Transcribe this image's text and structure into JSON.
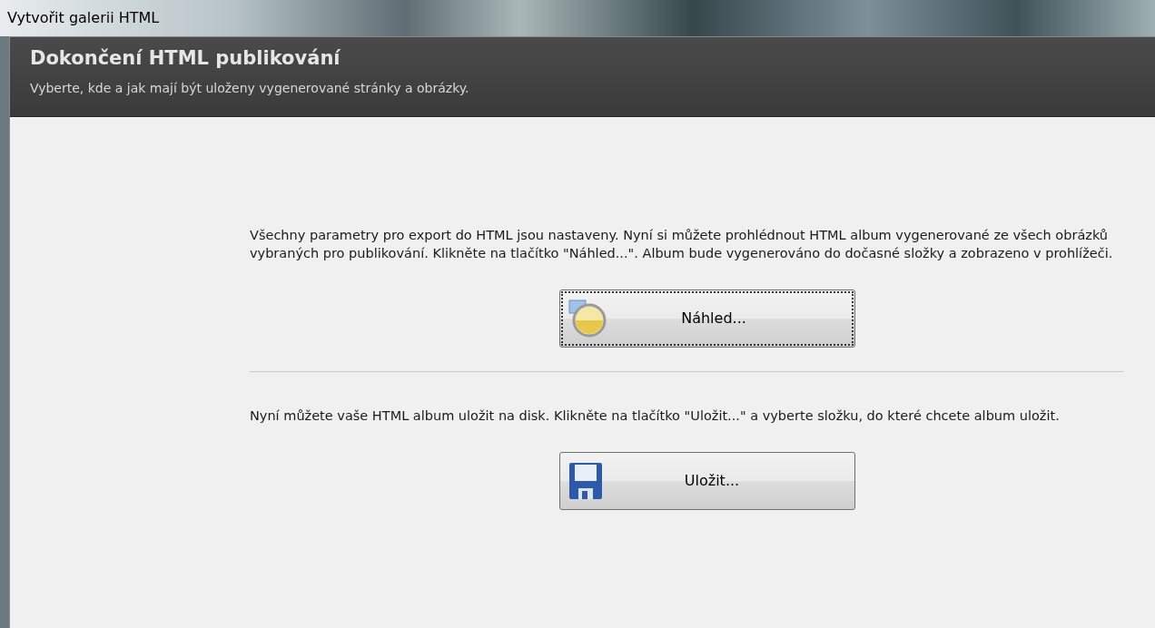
{
  "window": {
    "title": "Vytvořit galerii HTML"
  },
  "header": {
    "title": "Dokončení HTML publikování",
    "subtitle": "Vyberte, kde a jak mají být uloženy vygenerované stránky a obrázky."
  },
  "sections": [
    {
      "text": "Všechny parametry pro export do HTML jsou nastaveny. Nyní si můžete prohlédnout HTML album vygenerované ze všech obrázků vybraných pro publikování. Klikněte na tlačítko \"Náhled...\". Album bude vygenerováno do dočasné složky a zobrazeno v prohlížeči.",
      "button": {
        "kind": "preview",
        "label": "Náhled...",
        "focused": true
      }
    },
    {
      "text": "Nyní můžete vaše HTML album uložit na disk. Klikněte na tlačítko \"Uložit...\" a vyberte složku, do které chcete album uložit.",
      "button": {
        "kind": "save",
        "label": "Uložit...",
        "focused": false
      }
    }
  ]
}
